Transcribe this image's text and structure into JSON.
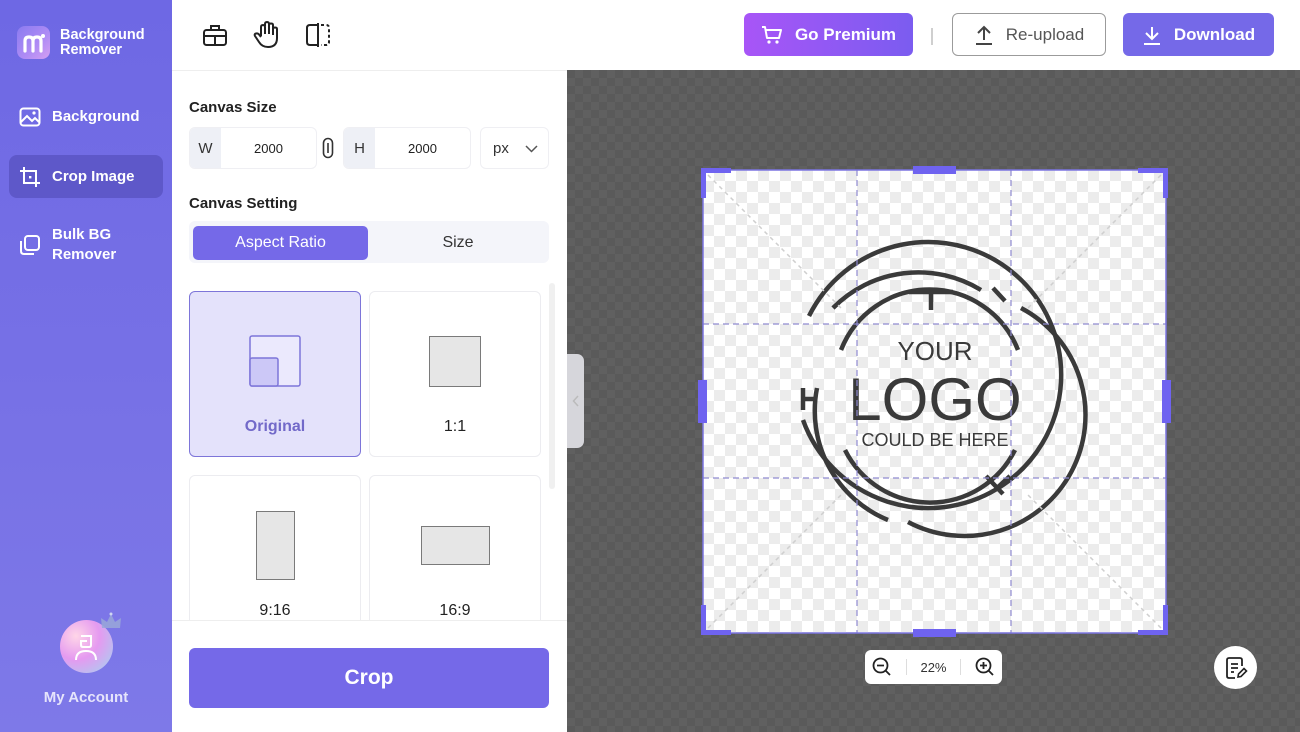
{
  "brand": {
    "name_line1": "Background",
    "name_line2": "Remover",
    "logo_icon": "m-logo-icon"
  },
  "sidebar": {
    "items": [
      {
        "label": "Background",
        "icon": "image-icon",
        "active": false
      },
      {
        "label": "Crop Image",
        "icon": "crop-icon",
        "active": true
      },
      {
        "label": "Bulk BG Remover",
        "label_line1": "Bulk BG",
        "label_line2": "Remover",
        "icon": "layers-icon",
        "active": false
      }
    ],
    "account_label": "My Account"
  },
  "toolbar": {
    "tools": [
      "toolbox-icon",
      "hand-icon",
      "compare-icon"
    ],
    "premium_label": "Go Premium",
    "reupload_label": "Re-upload",
    "download_label": "Download"
  },
  "panel": {
    "canvas_size_title": "Canvas Size",
    "width_prefix": "W",
    "width_value": "2000",
    "height_prefix": "H",
    "height_value": "2000",
    "unit": "px",
    "canvas_setting_title": "Canvas Setting",
    "tabs": [
      {
        "label": "Aspect Ratio",
        "active": true
      },
      {
        "label": "Size",
        "active": false
      }
    ],
    "ratios": [
      {
        "label": "Original",
        "selected": true
      },
      {
        "label": "1:1",
        "selected": false
      },
      {
        "label": "9:16",
        "selected": false
      },
      {
        "label": "16:9",
        "selected": false
      }
    ],
    "crop_label": "Crop"
  },
  "canvas": {
    "logo_line1": "YOUR",
    "logo_line2": "LOGO",
    "logo_line3": "COULD BE HERE",
    "zoom_value": "22%"
  },
  "colors": {
    "accent": "#7569e8",
    "sidebar": "#6e68e4",
    "premium_start": "#a855f7",
    "crop_handle": "#6f63f0",
    "canvas_bg": "#5a5a5a"
  }
}
